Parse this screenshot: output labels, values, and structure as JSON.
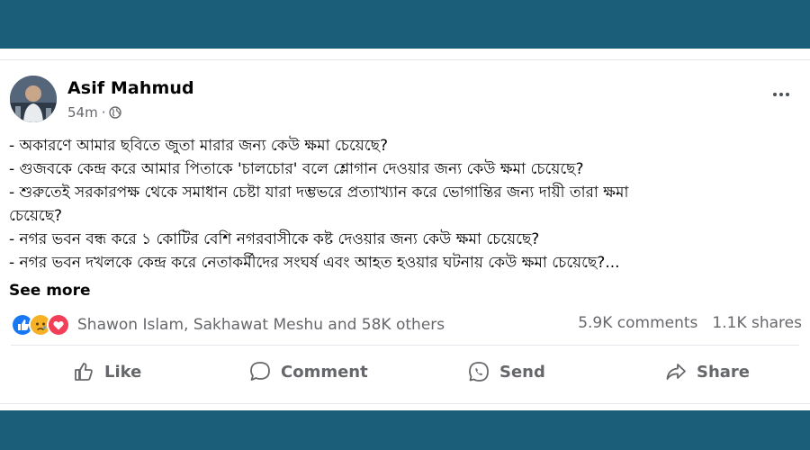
{
  "post": {
    "author": "Asif Mahmud",
    "time": "54m",
    "separator": "·",
    "privacy_icon": "globe-icon",
    "lines": [
      "- অকারণে আমার ছবিতে জুতা মারার জন্য কেউ ক্ষমা চেয়েছে?",
      "- গুজবকে কেন্দ্র করে আমার পিতাকে 'চালচোর' বলে শ্লোগান দেওয়ার জন্য কেউ ক্ষমা চেয়েছে?",
      "- শুরুতেই সরকারপক্ষ থেকে সমাধান চেষ্টা যারা দম্ভভরে প্রত্যাখ্যান করে ভোগান্তির জন্য দায়ী তারা ক্ষমা",
      "চেয়েছে?",
      "- নগর ভবন বন্ধ করে ১ কোটির বেশি নগরবাসীকে কষ্ট দেওয়ার জন্য কেউ ক্ষমা চেয়েছে?",
      "- নগর ভবন দখলকে কেন্দ্র করে নেতাকর্মীদের সংঘর্ষ এবং আহত হওয়ার ঘটনায় কেউ ক্ষমা চেয়েছে?..."
    ],
    "see_more": "See more"
  },
  "reactions": {
    "icons": [
      "like-reaction-icon",
      "sad-reaction-icon",
      "love-reaction-icon"
    ],
    "names": "Shawon Islam, Sakhawat Meshu and 58K others",
    "comments": "5.9K comments",
    "shares": "1.1K shares"
  },
  "actions": {
    "like": "Like",
    "comment": "Comment",
    "send": "Send",
    "share": "Share"
  },
  "colors": {
    "band": "#1b5e7a",
    "like_blue": "#1877f2",
    "love_red": "#f33e58",
    "sad_yellow": "#f7b125",
    "muted_text": "#65676b"
  }
}
